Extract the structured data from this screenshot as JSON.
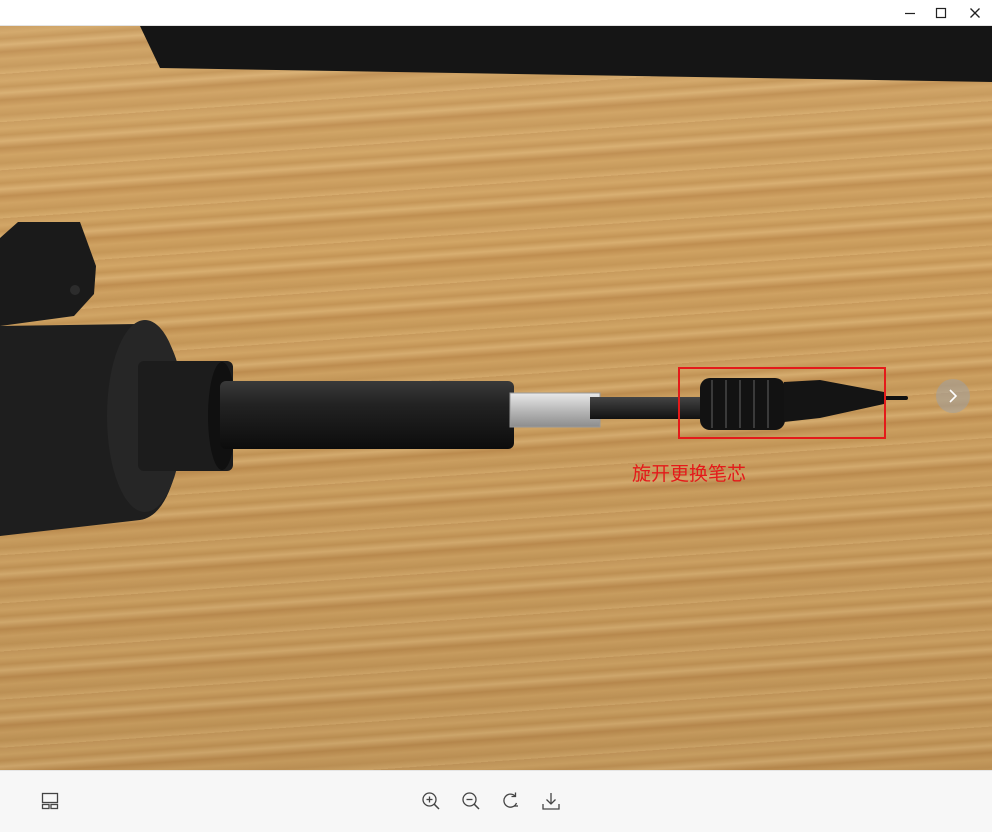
{
  "window": {
    "minimize_icon": "minimize-icon",
    "maximize_icon": "maximize-icon",
    "close_icon": "close-icon"
  },
  "image": {
    "annotation_text": "旋开更换笔芯",
    "annotation_color": "#e41a1a"
  },
  "navigation": {
    "next_icon": "chevron-right-icon"
  },
  "toolbar": {
    "thumbnail_icon": "thumbnail-layout-icon",
    "zoom_in_icon": "zoom-in-icon",
    "zoom_out_icon": "zoom-out-icon",
    "rotate_icon": "rotate-icon",
    "download_icon": "download-icon"
  }
}
